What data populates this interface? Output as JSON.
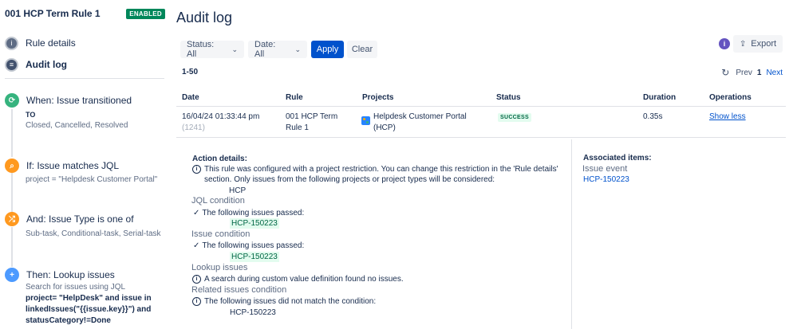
{
  "rule": {
    "name": "001 HCP Term Rule 1",
    "status_badge": "ENABLED"
  },
  "nav": {
    "rule_details": "Rule details",
    "audit_log": "Audit log"
  },
  "components": [
    {
      "title": "When: Issue transitioned",
      "lines": [
        "TO",
        "Closed, Cancelled, Resolved"
      ],
      "color": "#36b37e",
      "icon": "transition-icon"
    },
    {
      "title": "If: Issue matches JQL",
      "lines": [
        "project = \"Helpdesk Customer Portal\""
      ],
      "color": "#ff991f",
      "icon": "search-icon"
    },
    {
      "title": "And: Issue Type is one of",
      "lines": [
        "Sub-task, Conditional-task, Serial-task"
      ],
      "color": "#ff991f",
      "icon": "shuffle-icon"
    },
    {
      "title": "Then: Lookup issues",
      "lines": [
        "Search for issues using JQL",
        "project= \"HelpDesk\" and issue in",
        "linkedIssues(\"{{issue.key}}\") and",
        "statusCategory!=Done"
      ],
      "color": "#4c9aff",
      "icon": "plus-icon"
    }
  ],
  "main": {
    "title": "Audit log",
    "filters": {
      "status": "Status: All",
      "date": "Date: All",
      "apply": "Apply",
      "clear": "Clear"
    },
    "info": "i",
    "export": "Export",
    "range": "1-50",
    "pager": {
      "prev": "Prev",
      "page": "1",
      "next": "Next"
    },
    "columns": [
      "Date",
      "Rule",
      "Projects",
      "Status",
      "Duration",
      "Operations"
    ],
    "row": {
      "date": "16/04/24 01:33:44 pm",
      "id": "(1241)",
      "rule_line1": "001 HCP Term",
      "rule_line2": "Rule 1",
      "project_line1": "Helpdesk Customer Portal",
      "project_line2": "(HCP)",
      "status": "SUCCESS",
      "duration": "0.35s",
      "operation": "Show less"
    }
  },
  "details": {
    "title": "Action details:",
    "restriction_line1": "This rule was configured with a project restriction. You can change this restriction in the 'Rule details'",
    "restriction_line2": "section. Only issues from the following projects or project types will be considered:",
    "restriction_project": "HCP",
    "jql_section": "JQL condition",
    "jql_passed": "The following issues passed:",
    "jql_issue": "HCP-150223",
    "issue_section": "Issue condition",
    "issue_passed": "The following issues passed:",
    "issue_issue": "HCP-150223",
    "lookup_section": "Lookup issues",
    "lookup_msg": "A search during custom value definition found no issues.",
    "related_section": "Related issues condition",
    "related_msg": "The following issues did not match the condition:",
    "related_issue": "HCP-150223"
  },
  "associated": {
    "title": "Associated items:",
    "label": "Issue event",
    "link": "HCP-150223"
  },
  "colors": {
    "accent": "#0052cc",
    "enabled": "#00875a",
    "success_bg": "#e3fcef",
    "success_text": "#006644"
  }
}
